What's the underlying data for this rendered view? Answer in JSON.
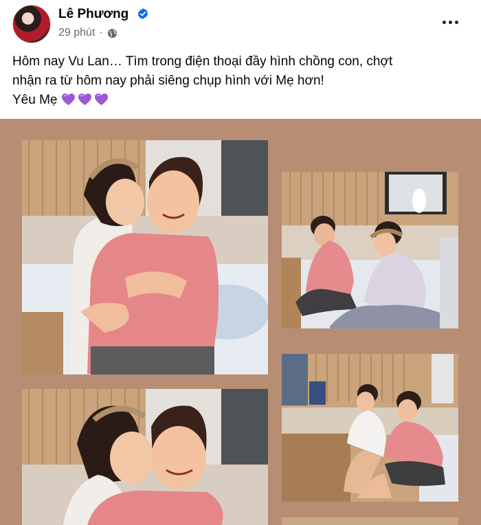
{
  "post": {
    "author": "Lê Phương",
    "time": "29 phút",
    "separator": "·",
    "caption_line1": "Hôm nay Vu Lan… Tìm trong điện thoại đầy hình chồng con, chợt",
    "caption_line2": "nhận ra từ hôm nay phải siêng chụp hình với Mẹ hơn!",
    "caption_line3": "Yêu Mẹ"
  },
  "colors": {
    "photo_background": "#b78d73",
    "verified_badge": "#0866ff",
    "heart": "#9b59d6",
    "meta_text": "#65676b"
  },
  "icons": {
    "verified": "verified-badge-icon",
    "audience": "globe-icon",
    "menu": "more-options-icon",
    "emoji": "purple-heart-icon"
  }
}
